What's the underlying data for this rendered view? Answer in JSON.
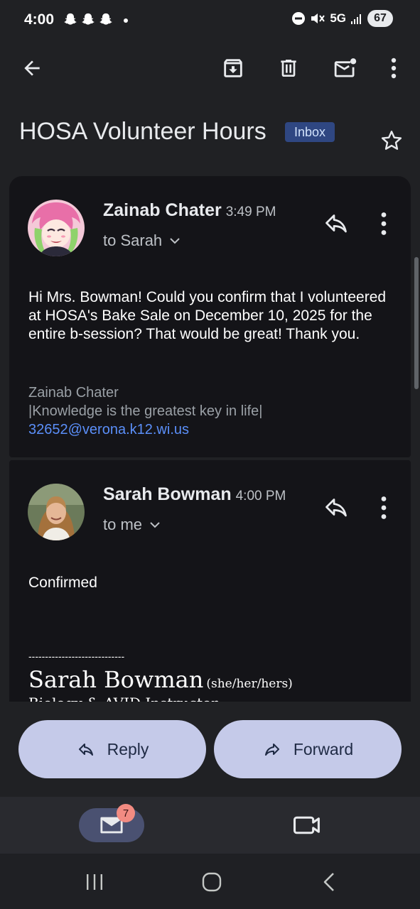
{
  "status": {
    "time": "4:00",
    "network": "5G",
    "battery": "67",
    "icons": [
      "snapchat-icon",
      "snapchat-icon",
      "snapchat-icon",
      "notification-dot",
      "dnd-icon",
      "mute-icon",
      "signal-icon"
    ]
  },
  "toolbar": {
    "icons": [
      "back-arrow-icon",
      "archive-icon",
      "delete-icon",
      "mark-unread-icon",
      "more-vert-icon"
    ]
  },
  "subject": {
    "title": "HOSA Volunteer Hours",
    "label": "Inbox"
  },
  "messages": [
    {
      "sender": "Zainab Chater",
      "time": "3:49 PM",
      "to": "to Sarah",
      "body": "Hi Mrs. Bowman! Could you confirm that I volunteered at HOSA's Bake Sale on December 10, 2025 for the entire b-session? That would be great! Thank you.",
      "signature": {
        "name": "Zainab Chater",
        "quote": "|Knowledge is the greatest key in life|",
        "email": "32652@verona.k12.wi.us"
      }
    },
    {
      "sender": "Sarah Bowman",
      "time": "4:00 PM",
      "to": "to me",
      "body": "Confirmed",
      "signature": {
        "divider": "-----------------------------",
        "name": "Sarah Bowman",
        "pronouns": "(she/her/hers)",
        "title": "Biology & AVID Instructor"
      }
    }
  ],
  "actions": {
    "reply": "Reply",
    "forward": "Forward"
  },
  "bottom_nav": {
    "mail_badge": "7"
  },
  "colors": {
    "background": "#202124",
    "card": "#141418",
    "accent_pill": "#c5cae9",
    "link": "#5b8ff9",
    "inbox_chip": "#2f4782",
    "badge": "#f28b82"
  }
}
